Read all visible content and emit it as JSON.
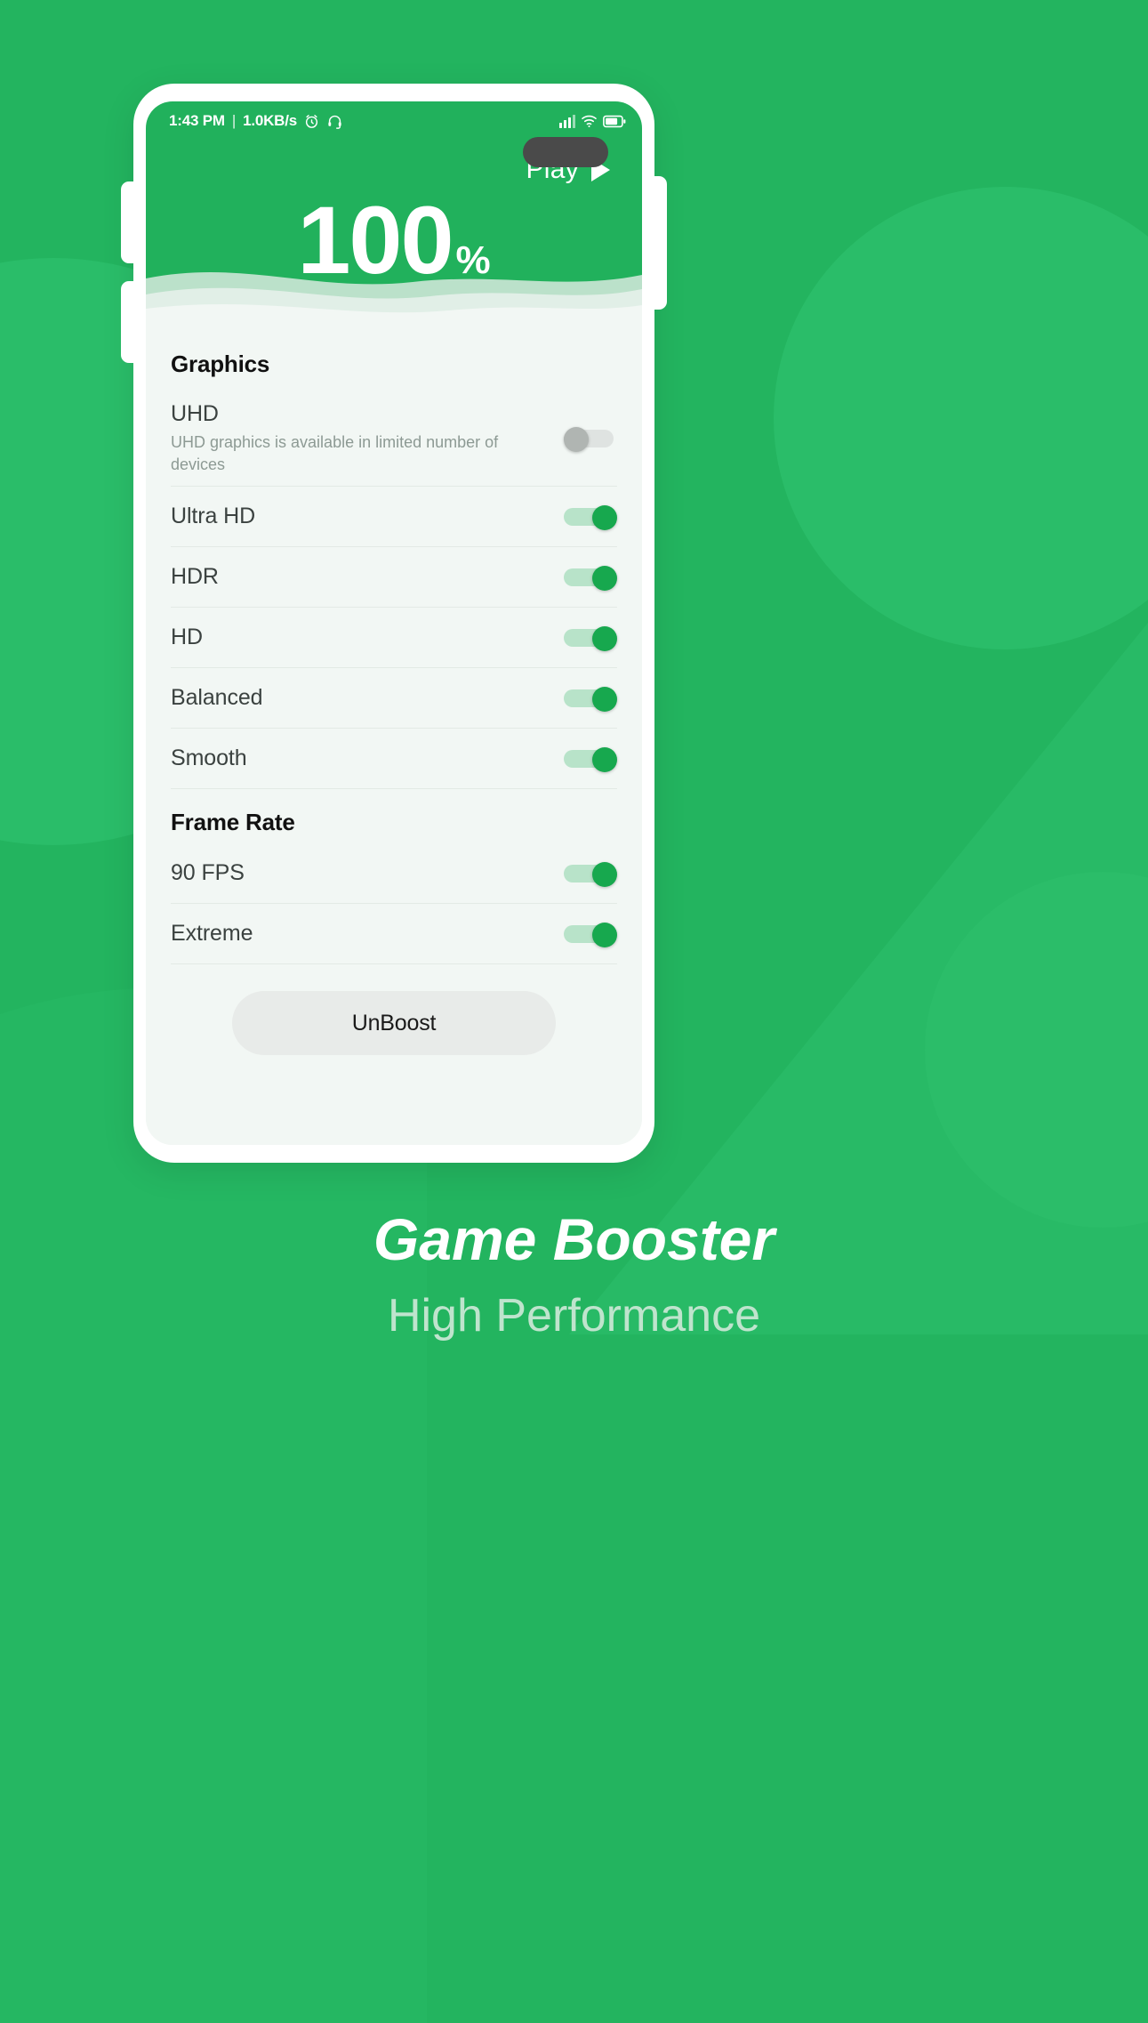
{
  "background": {
    "color": "#23b45f",
    "blob_color": "#2fc06c"
  },
  "phone": {
    "side_buttons": [
      "volume-up",
      "volume-down",
      "power"
    ]
  },
  "status_bar": {
    "time": "1:43 PM",
    "separator": "|",
    "network_speed": "1.0KB/s",
    "icons": [
      "alarm-clock-icon",
      "headset-icon",
      "signal-icon",
      "wifi-icon",
      "battery-icon"
    ]
  },
  "header": {
    "play_label": "Play",
    "play_icon": "play-triangle-icon",
    "percent_value": "100",
    "percent_sign": "%",
    "background_color": "#21b15c"
  },
  "sections": [
    {
      "title": "Graphics",
      "rows": [
        {
          "title": "UHD",
          "subtitle": "UHD graphics is available in limited number of devices",
          "toggle": "off"
        },
        {
          "title": "Ultra HD",
          "subtitle": "",
          "toggle": "on"
        },
        {
          "title": "HDR",
          "subtitle": "",
          "toggle": "on"
        },
        {
          "title": "HD",
          "subtitle": "",
          "toggle": "on"
        },
        {
          "title": "Balanced",
          "subtitle": "",
          "toggle": "on"
        },
        {
          "title": "Smooth",
          "subtitle": "",
          "toggle": "on"
        }
      ]
    },
    {
      "title": "Frame Rate",
      "rows": [
        {
          "title": "90 FPS",
          "subtitle": "",
          "toggle": "on"
        },
        {
          "title": "Extreme",
          "subtitle": "",
          "toggle": "on"
        }
      ]
    }
  ],
  "action": {
    "unboost_label": "UnBoost"
  },
  "branding": {
    "title": "Game Booster",
    "subtitle": "High Performance",
    "title_color": "#ffffff",
    "subtitle_color": "#bfe4cd"
  },
  "toggle_colors": {
    "on_track": "#b8e3c9",
    "on_knob": "#17a84e",
    "off_track": "#dfe3e1",
    "off_knob": "#b0b5b2"
  }
}
